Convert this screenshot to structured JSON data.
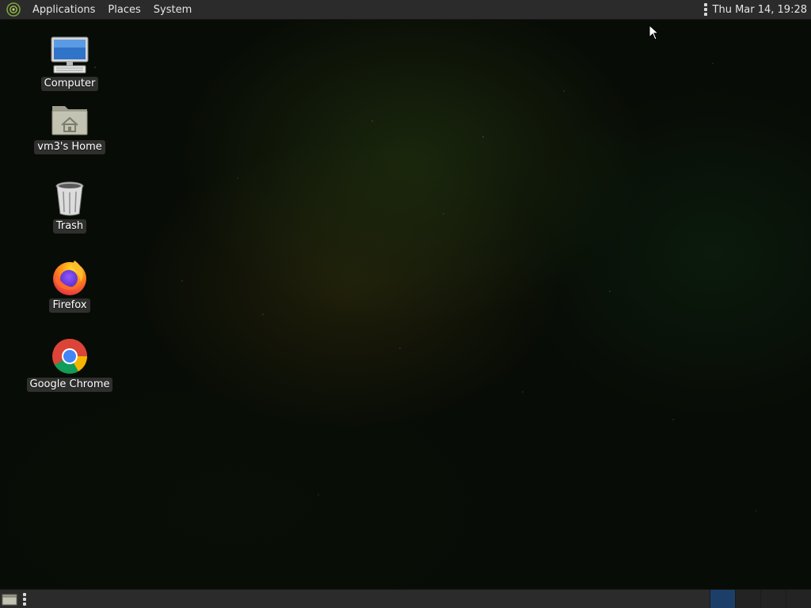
{
  "top_panel": {
    "menus": [
      "Applications",
      "Places",
      "System"
    ],
    "clock": "Thu Mar 14, 19:28"
  },
  "desktop": {
    "icons": [
      {
        "label": "Computer",
        "icon": "computer-icon"
      },
      {
        "label": "vm3's Home",
        "icon": "home-folder-icon"
      },
      {
        "label": "Trash",
        "icon": "trash-icon"
      },
      {
        "label": "Firefox",
        "icon": "firefox-icon"
      },
      {
        "label": "Google Chrome",
        "icon": "chrome-icon"
      }
    ]
  },
  "bottom_panel": {
    "workspace_count": 4,
    "active_workspace": 1
  },
  "colors": {
    "panel_bg": "#2b2b2b",
    "active_workspace": "#1c3f6a",
    "desktop_bg": "#080c06"
  }
}
